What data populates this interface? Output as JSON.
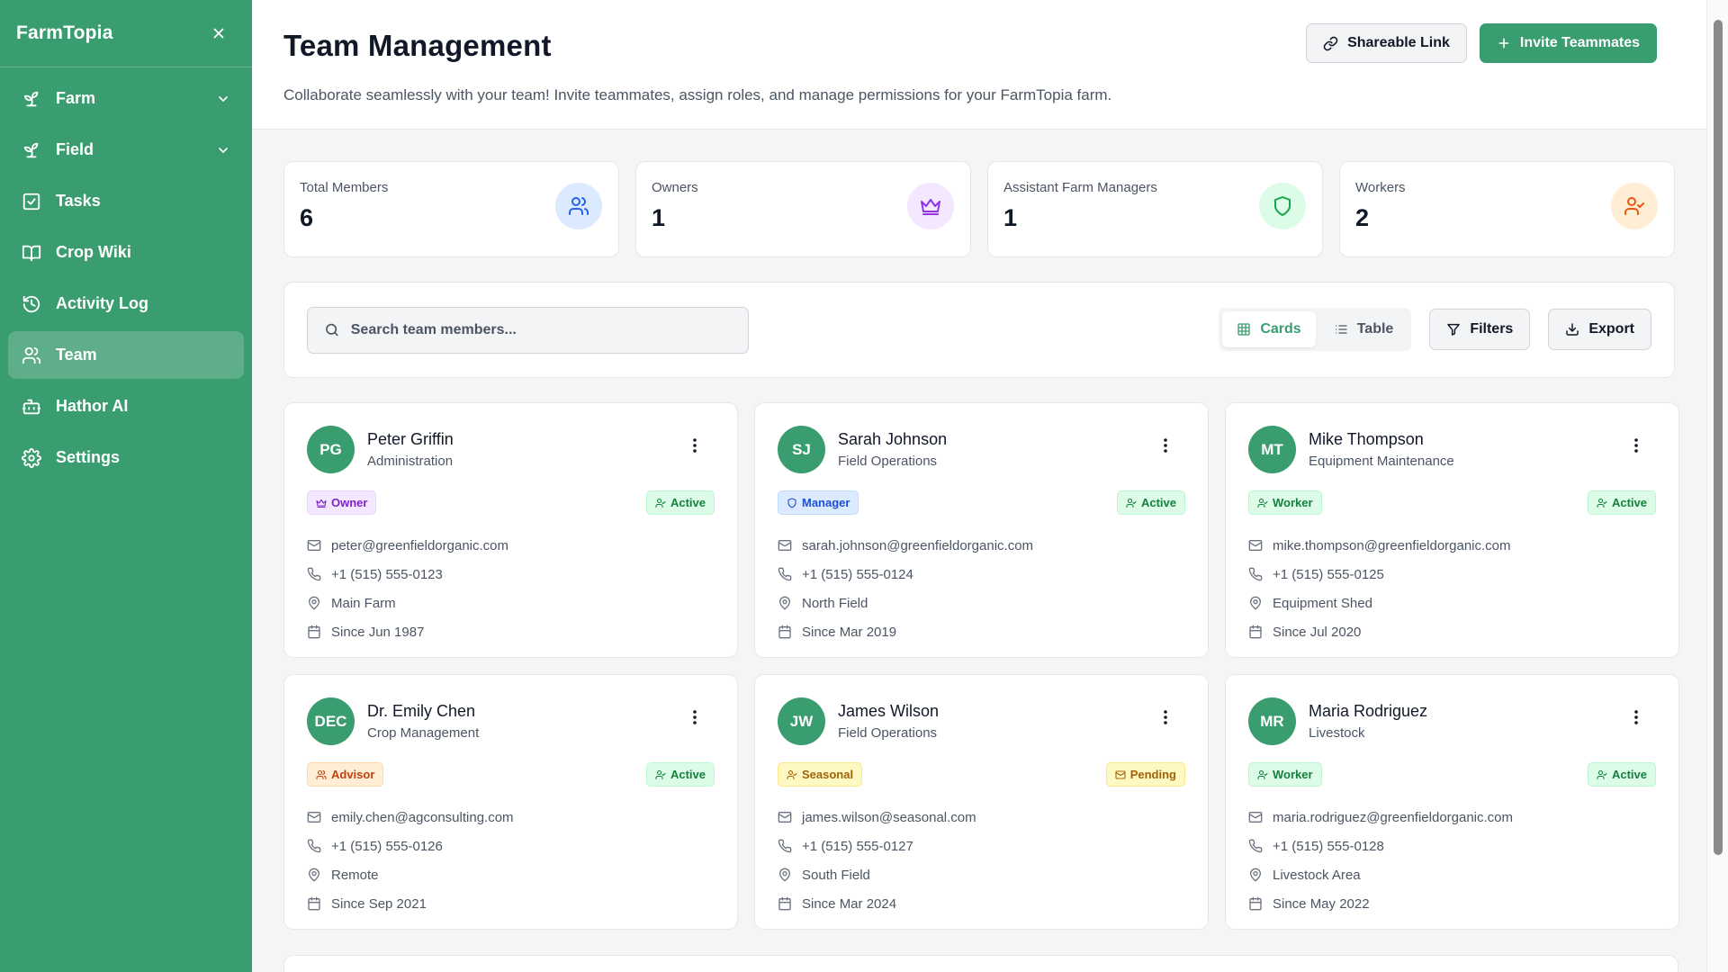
{
  "app": {
    "name": "FarmTopia"
  },
  "sidebar": {
    "items": [
      {
        "label": "Farm",
        "icon": "sprout-icon",
        "has_chevron": true
      },
      {
        "label": "Field",
        "icon": "sprout-icon",
        "has_chevron": true
      },
      {
        "label": "Tasks",
        "icon": "checkbox-icon",
        "has_chevron": false
      },
      {
        "label": "Crop Wiki",
        "icon": "book-icon",
        "has_chevron": false
      },
      {
        "label": "Activity Log",
        "icon": "history-icon",
        "has_chevron": false
      },
      {
        "label": "Team",
        "icon": "users-icon",
        "has_chevron": false,
        "active": true
      },
      {
        "label": "Hathor AI",
        "icon": "bot-icon",
        "has_chevron": false
      },
      {
        "label": "Settings",
        "icon": "gear-icon",
        "has_chevron": false
      }
    ]
  },
  "header": {
    "title": "Team Management",
    "subtitle": "Collaborate seamlessly with your team! Invite teammates, assign roles, and manage permissions for your FarmTopia farm.",
    "share_label": "Shareable Link",
    "invite_label": "Invite Teammates"
  },
  "stats": [
    {
      "label": "Total Members",
      "value": "6",
      "icon": "users-icon",
      "color": "#2563eb",
      "bg": "#dbeafe"
    },
    {
      "label": "Owners",
      "value": "1",
      "icon": "crown-icon",
      "color": "#9333ea",
      "bg": "#f3e8ff"
    },
    {
      "label": "Assistant Farm Managers",
      "value": "1",
      "icon": "shield-icon",
      "color": "#16a34a",
      "bg": "#dcfce7"
    },
    {
      "label": "Workers",
      "value": "2",
      "icon": "user-check-icon",
      "color": "#ea580c",
      "bg": "#ffedd5"
    }
  ],
  "toolbar": {
    "search_placeholder": "Search team members...",
    "cards_label": "Cards",
    "table_label": "Table",
    "filters_label": "Filters",
    "export_label": "Export"
  },
  "members": [
    {
      "initials": "PG",
      "name": "Peter Griffin",
      "dept": "Administration",
      "role": "Owner",
      "role_class": "b-owner",
      "status": "Active",
      "status_class": "b-active",
      "email": "peter@greenfieldorganic.com",
      "phone": "+1 (515) 555-0123",
      "location": "Main Farm",
      "since": "Since Jun 1987"
    },
    {
      "initials": "SJ",
      "name": "Sarah Johnson",
      "dept": "Field Operations",
      "role": "Manager",
      "role_class": "b-manager",
      "status": "Active",
      "status_class": "b-active",
      "email": "sarah.johnson@greenfieldorganic.com",
      "phone": "+1 (515) 555-0124",
      "location": "North Field",
      "since": "Since Mar 2019"
    },
    {
      "initials": "MT",
      "name": "Mike Thompson",
      "dept": "Equipment Maintenance",
      "role": "Worker",
      "role_class": "b-worker",
      "status": "Active",
      "status_class": "b-active",
      "email": "mike.thompson@greenfieldorganic.com",
      "phone": "+1 (515) 555-0125",
      "location": "Equipment Shed",
      "since": "Since Jul 2020"
    },
    {
      "initials": "DEC",
      "name": "Dr. Emily Chen",
      "dept": "Crop Management",
      "role": "Advisor",
      "role_class": "b-advisor",
      "status": "Active",
      "status_class": "b-active",
      "email": "emily.chen@agconsulting.com",
      "phone": "+1 (515) 555-0126",
      "location": "Remote",
      "since": "Since Sep 2021"
    },
    {
      "initials": "JW",
      "name": "James Wilson",
      "dept": "Field Operations",
      "role": "Seasonal",
      "role_class": "b-seasonal",
      "status": "Pending",
      "status_class": "b-pending",
      "email": "james.wilson@seasonal.com",
      "phone": "+1 (515) 555-0127",
      "location": "South Field",
      "since": "Since Mar 2024"
    },
    {
      "initials": "MR",
      "name": "Maria Rodriguez",
      "dept": "Livestock",
      "role": "Worker",
      "role_class": "b-worker",
      "status": "Active",
      "status_class": "b-active",
      "email": "maria.rodriguez@greenfieldorganic.com",
      "phone": "+1 (515) 555-0128",
      "location": "Livestock Area",
      "since": "Since May 2022"
    }
  ]
}
